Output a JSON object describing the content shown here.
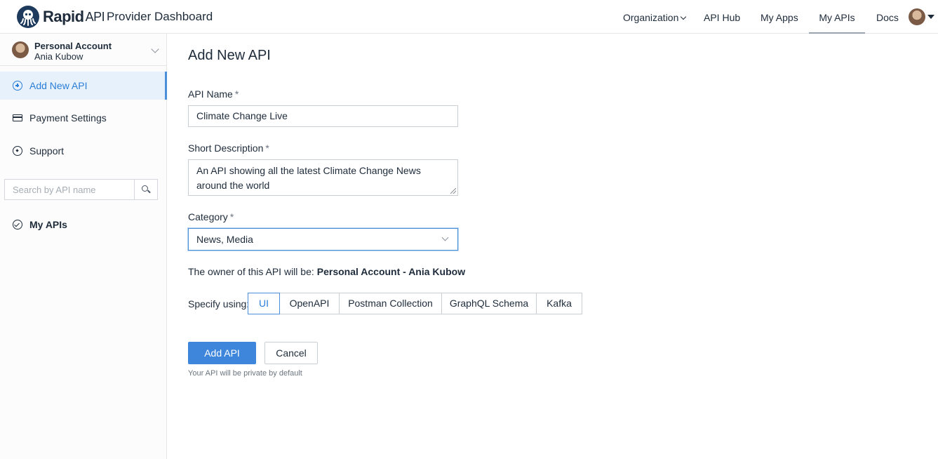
{
  "header": {
    "logo_brand": "Rapid",
    "logo_api": "API",
    "title": "Provider Dashboard",
    "nav": {
      "organization": "Organization",
      "api_hub": "API Hub",
      "my_apps": "My Apps",
      "my_apis": "My APIs",
      "docs": "Docs"
    }
  },
  "sidebar": {
    "account_type": "Personal Account",
    "account_name": "Ania Kubow",
    "items": {
      "add_new_api": "Add New API",
      "payment_settings": "Payment Settings",
      "support": "Support",
      "my_apis": "My APIs"
    },
    "search": {
      "placeholder": "Search by API name"
    }
  },
  "main": {
    "title": "Add New API",
    "api_name": {
      "label": "API Name",
      "required": "*",
      "value": "Climate Change Live"
    },
    "short_description": {
      "label": "Short Description",
      "required": "*",
      "value": "An API showing all the latest Climate Change News around the world"
    },
    "category": {
      "label": "Category",
      "required": "*",
      "value": "News, Media"
    },
    "owner": {
      "prefix": "The owner of this API will be:",
      "value": "Personal Account - Ania Kubow"
    },
    "specify": {
      "label": "Specify using:",
      "options": [
        "UI",
        "OpenAPI",
        "Postman Collection",
        "GraphQL Schema",
        "Kafka"
      ],
      "selected": "UI"
    },
    "add_button": "Add API",
    "cancel_button": "Cancel",
    "hint": "Your API will be private by default"
  },
  "colors": {
    "accent": "#3d86dc",
    "active_bg": "#e6f1fb"
  }
}
